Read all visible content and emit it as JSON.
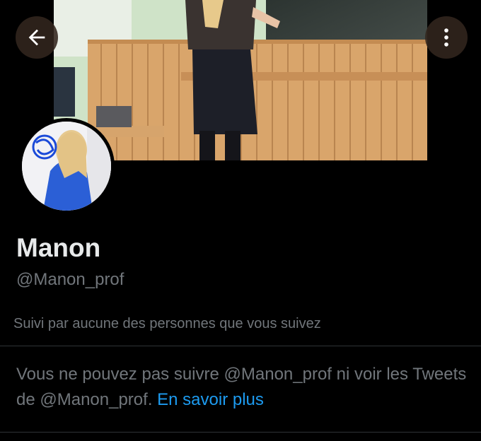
{
  "header": {
    "back_icon": "arrow-left-icon",
    "more_icon": "more-vertical-icon"
  },
  "profile": {
    "display_name": "Manon",
    "handle": "@Manon_prof",
    "followed_by": "Suivi par aucune des personnes que vous suivez"
  },
  "notice": {
    "text": "Vous ne pouvez pas suivre @Manon_prof ni voir les Tweets de @Manon_prof. ",
    "link_label": "En savoir plus"
  },
  "colors": {
    "background": "#000000",
    "text_primary": "#e7e9ea",
    "text_secondary": "#71767b",
    "link": "#1d9bf0",
    "divider": "#2f3336"
  }
}
